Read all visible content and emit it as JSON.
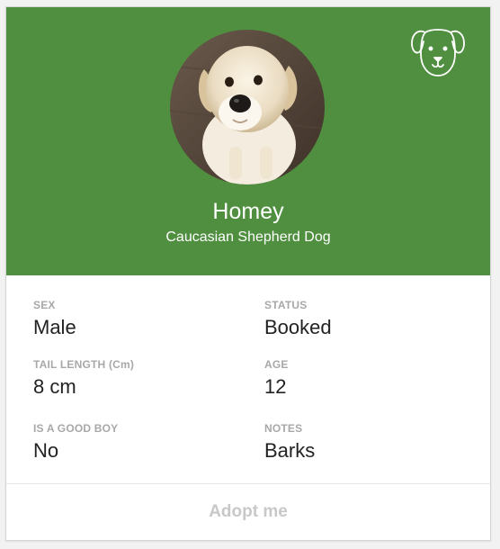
{
  "colors": {
    "header_bg": "#4f8f3f",
    "label": "#a8a8a8",
    "value": "#222222",
    "button_text": "#c8c8c8"
  },
  "header": {
    "icon": "dog-face-icon",
    "photo": "dog-photo",
    "name": "Homey",
    "breed": "Caucasian Shepherd Dog"
  },
  "details": [
    {
      "label": "SEX",
      "value": "Male"
    },
    {
      "label": "STATUS",
      "value": "Booked"
    },
    {
      "label": "TAIL LENGTH (Cm)",
      "value": "8 cm"
    },
    {
      "label": "AGE",
      "value": "12"
    },
    {
      "label": "IS A GOOD BOY",
      "value": "No"
    },
    {
      "label": "NOTES",
      "value": "Barks"
    }
  ],
  "actions": {
    "adopt_label": "Adopt me"
  }
}
